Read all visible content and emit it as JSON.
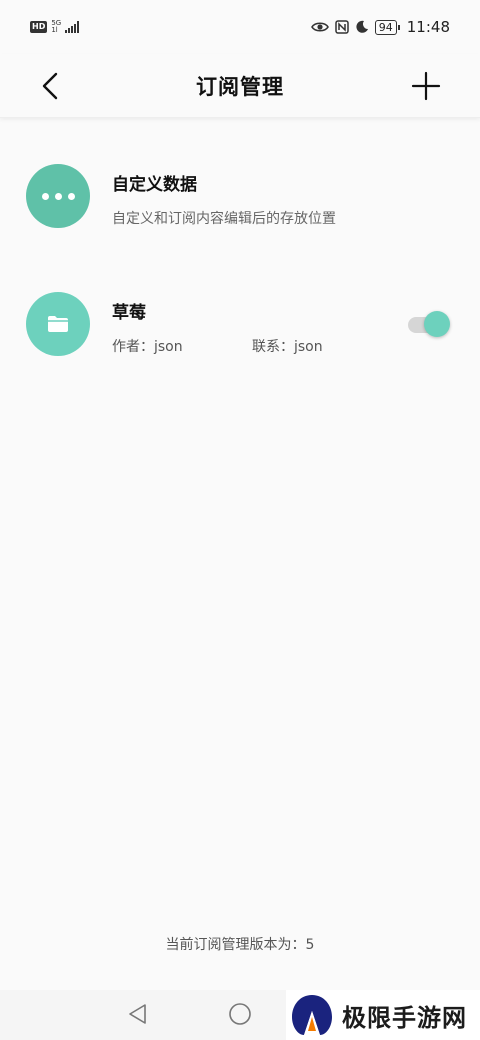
{
  "status_bar": {
    "hd_badge": "HD",
    "network_type": "5G",
    "network_sub": "1l",
    "battery": "94",
    "time": "11:48",
    "icons": [
      "hd-icon",
      "signal-icon",
      "eye-icon",
      "nfc-icon",
      "moon-icon",
      "battery-icon"
    ]
  },
  "header": {
    "title": "订阅管理",
    "back_icon": "chevron-left-icon",
    "add_icon": "plus-icon"
  },
  "subscriptions": [
    {
      "title": "自定义数据",
      "description": "自定义和订阅内容编辑后的存放位置",
      "icon": "more-dots-icon",
      "color": "#5fc1a8"
    },
    {
      "title": "草莓",
      "author": "作者：json",
      "contact": "联系：json",
      "icon": "folder-icon",
      "color": "#6dd1bd",
      "enabled": true
    }
  ],
  "footer": {
    "version_text": "当前订阅管理版本为：5"
  },
  "watermark": {
    "text": "极限手游网"
  },
  "colors": {
    "accent": "#6dd1bd",
    "accent_dark": "#5fc1a8",
    "background": "#fafafa"
  }
}
